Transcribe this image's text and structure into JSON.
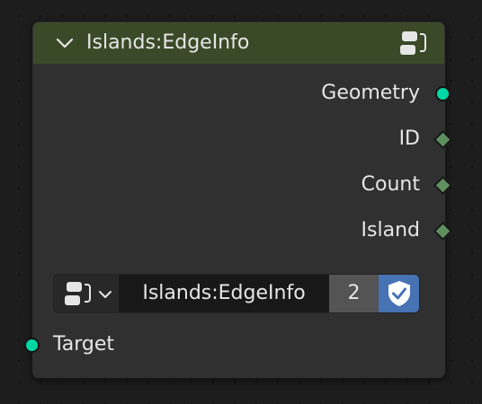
{
  "node": {
    "title": "Islands:EdgeInfo",
    "header_color": "#3a4a28",
    "body_color": "#303030",
    "header_icons": [
      "chevron-down-icon",
      "node-group-icon"
    ],
    "outputs": [
      {
        "label": "Geometry",
        "socket": "circle",
        "color": "#00d6a3"
      },
      {
        "label": "ID",
        "socket": "diamond",
        "color": "#5f8e5f"
      },
      {
        "label": "Count",
        "socket": "diamond",
        "color": "#5f8e5f"
      },
      {
        "label": "Island",
        "socket": "diamond",
        "color": "#5f8e5f"
      }
    ],
    "group_selector": {
      "icon": "node-group-icon",
      "name": "Islands:EdgeInfo",
      "users": "2",
      "fake_user_icon": "shield-check-icon",
      "fake_user_color": "#4772b3"
    },
    "inputs": [
      {
        "label": "Target",
        "socket": "circle",
        "color": "#00d6a3"
      }
    ]
  }
}
